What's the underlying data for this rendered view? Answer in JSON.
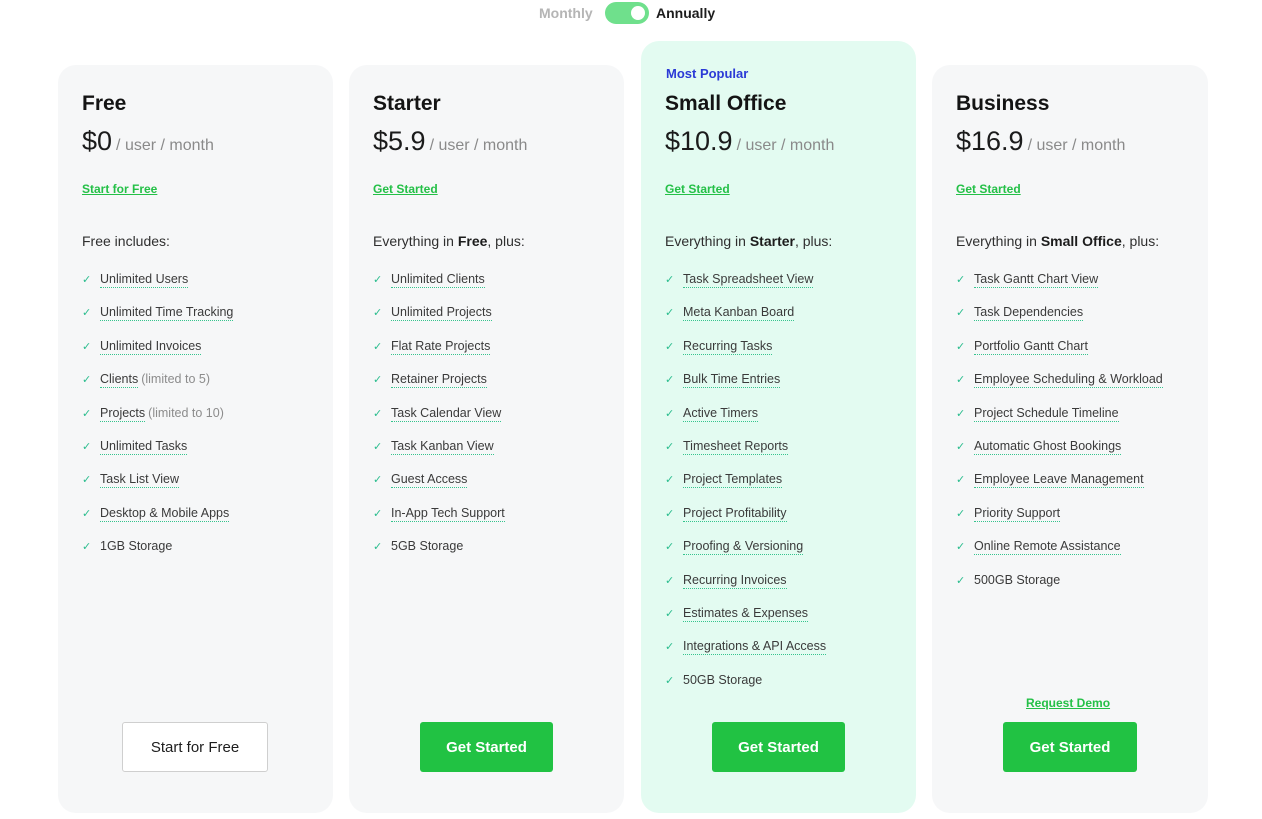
{
  "billing_toggle": {
    "monthly_label": "Monthly",
    "annually_label": "Annually",
    "selected": "Annually"
  },
  "plans": [
    {
      "name": "Free",
      "badge": "",
      "price": "$0",
      "price_unit": "/ user / month",
      "top_link": "Start for Free",
      "includes_prefix": "Free includes:",
      "includes_bold": "",
      "includes_suffix": "",
      "features": [
        {
          "text": "Unlimited Users",
          "note": ""
        },
        {
          "text": "Unlimited Time Tracking",
          "note": ""
        },
        {
          "text": "Unlimited Invoices",
          "note": ""
        },
        {
          "text": "Clients",
          "note": "(limited to 5)"
        },
        {
          "text": "Projects",
          "note": "(limited to 10)"
        },
        {
          "text": "Unlimited Tasks",
          "note": ""
        },
        {
          "text": "Task List View",
          "note": ""
        },
        {
          "text": "Desktop & Mobile Apps",
          "note": ""
        },
        {
          "text": "1GB Storage",
          "note": ""
        }
      ],
      "cta": "Start for Free"
    },
    {
      "name": "Starter",
      "badge": "",
      "price": "$5.9",
      "price_unit": "/ user / month",
      "top_link": "Get Started",
      "includes_prefix": "Everything in ",
      "includes_bold": "Free",
      "includes_suffix": ", plus:",
      "features": [
        {
          "text": "Unlimited Clients",
          "note": ""
        },
        {
          "text": "Unlimited Projects",
          "note": ""
        },
        {
          "text": "Flat Rate Projects",
          "note": ""
        },
        {
          "text": "Retainer Projects",
          "note": ""
        },
        {
          "text": "Task Calendar View",
          "note": ""
        },
        {
          "text": "Task Kanban View",
          "note": ""
        },
        {
          "text": "Guest Access",
          "note": ""
        },
        {
          "text": "In-App Tech Support",
          "note": ""
        },
        {
          "text": "5GB Storage",
          "note": ""
        }
      ],
      "cta": "Get Started"
    },
    {
      "name": "Small Office",
      "badge": "Most Popular",
      "price": "$10.9",
      "price_unit": "/ user / month",
      "top_link": "Get Started",
      "includes_prefix": "Everything in ",
      "includes_bold": "Starter",
      "includes_suffix": ", plus:",
      "features": [
        {
          "text": "Task Spreadsheet View",
          "note": ""
        },
        {
          "text": "Meta Kanban Board",
          "note": ""
        },
        {
          "text": "Recurring Tasks",
          "note": ""
        },
        {
          "text": "Bulk Time Entries",
          "note": ""
        },
        {
          "text": "Active Timers",
          "note": ""
        },
        {
          "text": "Timesheet Reports",
          "note": ""
        },
        {
          "text": "Project Templates",
          "note": ""
        },
        {
          "text": "Project Profitability",
          "note": ""
        },
        {
          "text": "Proofing & Versioning",
          "note": ""
        },
        {
          "text": "Recurring Invoices",
          "note": ""
        },
        {
          "text": "Estimates & Expenses",
          "note": ""
        },
        {
          "text": "Integrations & API Access",
          "note": ""
        },
        {
          "text": "50GB Storage",
          "note": ""
        }
      ],
      "cta": "Get Started"
    },
    {
      "name": "Business",
      "badge": "",
      "price": "$16.9",
      "price_unit": "/ user / month",
      "top_link": "Get Started",
      "includes_prefix": "Everything in ",
      "includes_bold": "Small Office",
      "includes_suffix": ", plus:",
      "features": [
        {
          "text": "Task Gantt Chart View",
          "note": ""
        },
        {
          "text": "Task Dependencies",
          "note": ""
        },
        {
          "text": "Portfolio Gantt Chart",
          "note": ""
        },
        {
          "text": "Employee Scheduling & Workload",
          "note": ""
        },
        {
          "text": "Project Schedule Timeline",
          "note": ""
        },
        {
          "text": "Automatic Ghost Bookings",
          "note": ""
        },
        {
          "text": "Employee Leave Management",
          "note": ""
        },
        {
          "text": "Priority Support",
          "note": ""
        },
        {
          "text": "Online Remote Assistance",
          "note": ""
        },
        {
          "text": "500GB Storage",
          "note": ""
        }
      ],
      "demo_link": "Request Demo",
      "cta": "Get Started"
    }
  ],
  "colors": {
    "accent_green": "#21c243",
    "badge_blue": "#2b3ad6",
    "highlight_bg": "#e3fbf1",
    "card_bg": "#f6f7f8"
  },
  "icons": {
    "feature_bullet": "check-icon"
  }
}
